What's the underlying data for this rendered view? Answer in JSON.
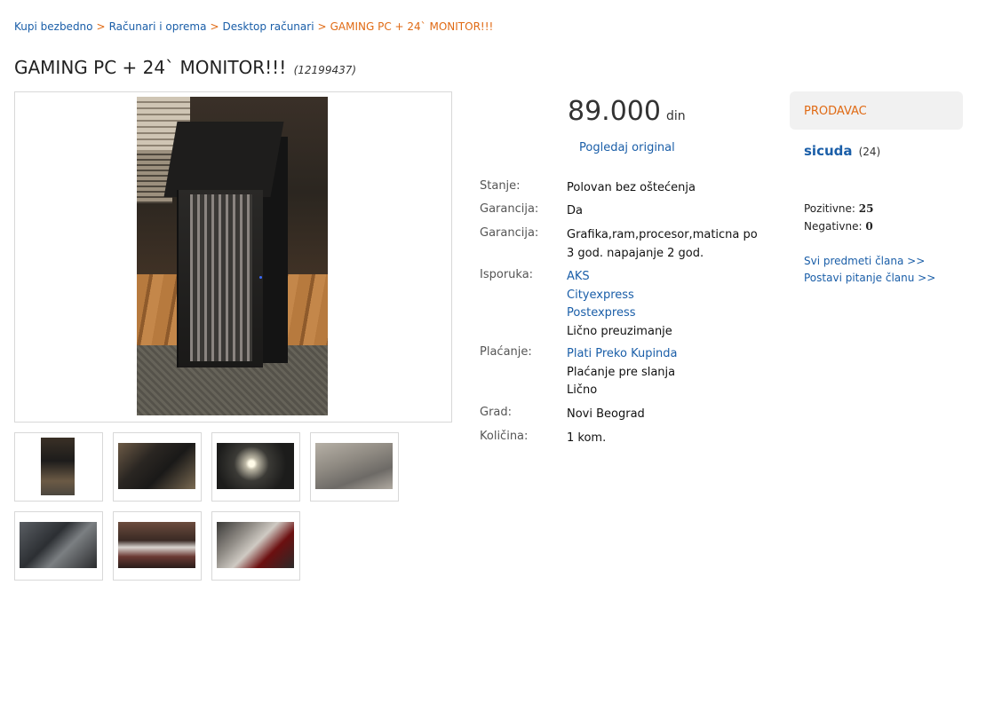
{
  "breadcrumb": {
    "items": [
      "Kupi bezbedno",
      "Računari i oprema",
      "Desktop računari"
    ],
    "separator": ">",
    "current": "GAMING PC + 24` MONITOR!!!"
  },
  "listing": {
    "title": "GAMING PC + 24` MONITOR!!!",
    "item_id": "(12199437)",
    "price": "89.000",
    "currency": "din",
    "original_link": "Pogledaj original"
  },
  "details": {
    "stanje": {
      "label": "Stanje:",
      "value": "Polovan bez oštećenja"
    },
    "garancija": {
      "label": "Garancija:",
      "value": "Da"
    },
    "garancija_detail": {
      "label": "Garancija:",
      "lines": [
        "Grafika,ram,procesor,maticna po",
        "3 god. napajanje 2 god."
      ]
    },
    "isporuka": {
      "label": "Isporuka:",
      "links": [
        "AKS",
        "Cityexpress",
        "Postexpress"
      ],
      "text": "Lično preuzimanje"
    },
    "placanje": {
      "label": "Plaćanje:",
      "link": "Plati Preko Kupinda",
      "lines": [
        "Plaćanje pre slanja",
        "Lično"
      ]
    },
    "grad": {
      "label": "Grad:",
      "value": "Novi Beograd"
    },
    "kolicina": {
      "label": "Količina:",
      "value": "1 kom."
    }
  },
  "seller": {
    "header": "PRODAVAC",
    "name": "sicuda",
    "count": "(24)",
    "positive_label": "Pozitivne:",
    "positive": "25",
    "negative_label": "Negativne:",
    "negative": "0",
    "links": [
      "Svi predmeti člana >>",
      "Postavi pitanje članu >>"
    ]
  },
  "colors": {
    "link": "#1a5ea8",
    "accent": "#e06a14",
    "panel": "#f1f1f1"
  }
}
